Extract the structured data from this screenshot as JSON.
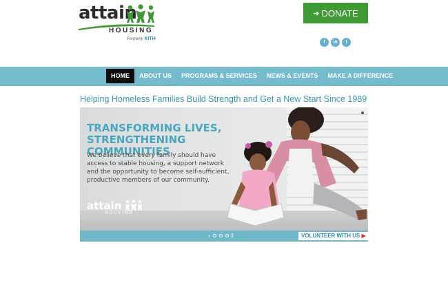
{
  "logo": {
    "word": "attain",
    "subword": "HOUSING",
    "formerly": "Formerly",
    "formerly_name": "KITH"
  },
  "donate": {
    "label": "DONATE"
  },
  "social": [
    {
      "icon": "facebook-icon",
      "glyph": "f"
    },
    {
      "icon": "linkedin-icon",
      "glyph": "in"
    },
    {
      "icon": "twitter-icon",
      "glyph": "t"
    }
  ],
  "nav": [
    {
      "label": "HOME",
      "active": true
    },
    {
      "label": "ABOUT US"
    },
    {
      "label": "PROGRAMS & SERVICES"
    },
    {
      "label": "NEWS & EVENTS"
    },
    {
      "label": "MAKE A DIFFERENCE"
    }
  ],
  "tagline": "Helping Homeless Families Build Strength and Get a New Start Since 1989",
  "banner": {
    "title_line1": "TRANSFORMING LIVES,",
    "title_line2": "STRENGTHENING COMMUNITIES",
    "body": "We believe that every family should have access to stable housing, a support network and the opportunity to become self-sufficient, productive members of our community.",
    "logo_word": "attain",
    "logo_sub": "HOUSING",
    "cta": "VOLUNTEER WITH US"
  },
  "colors": {
    "accent": "#74bccc",
    "donate": "#3f9a36",
    "tagline": "#3c95b0",
    "cta_arrow": "#d6324a"
  }
}
